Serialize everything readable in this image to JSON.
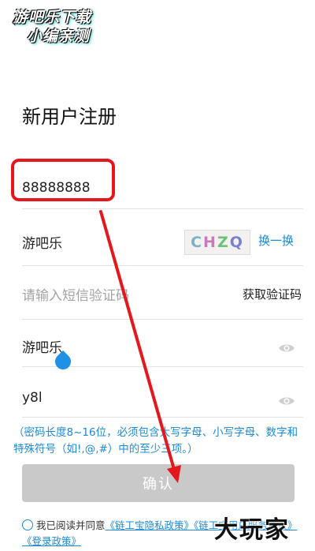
{
  "watermark": {
    "line1": "游吧乐下载",
    "line2": "小编亲测"
  },
  "header": {
    "back_icon": "chevron-left-icon",
    "back_glyph": "‹"
  },
  "page": {
    "title": "新用户注册"
  },
  "form": {
    "phone_value": "88888888",
    "captcha_input_value": "游吧乐",
    "captcha_image_text": "CHZQ",
    "refresh_captcha_label": "换一换",
    "sms_placeholder": "请输入短信验证码",
    "get_sms_label": "获取验证码",
    "password_value": "游吧乐",
    "confirm_password_value": "y8l",
    "password_hint": "（密码长度8~16位，必须包含大写字母、小写字母、数字和特殊符号（如!,@,#）中的至少三项。）",
    "confirm_label": "确认"
  },
  "agreement": {
    "prefix": "我已阅读并同意",
    "privacy_link": "《链工宝隐私政策》",
    "service_link": "《链工宝用户服务协议》",
    "login_link": "《登录政策》"
  },
  "brand_watermark": "大玩家",
  "colors": {
    "accent": "#1c8ad9",
    "highlight": "#e4171d",
    "button_disabled": "#c9c9c9"
  }
}
